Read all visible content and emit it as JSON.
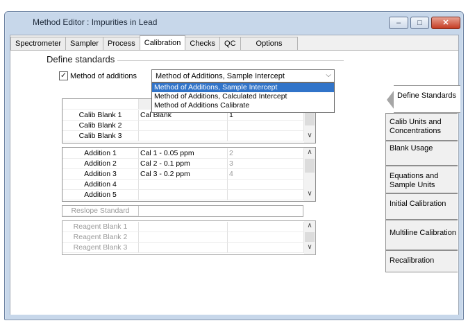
{
  "window": {
    "title": "Method Editor : Impurities in Lead",
    "min_icon": "minimize-icon",
    "max_icon": "restore-icon",
    "close_icon": "close-icon"
  },
  "tabs": [
    {
      "label": "Spectrometer"
    },
    {
      "label": "Sampler"
    },
    {
      "label": "Process"
    },
    {
      "label": "Calibration",
      "active": true
    },
    {
      "label": "Checks"
    },
    {
      "label": "QC"
    },
    {
      "label": "Options"
    }
  ],
  "define": {
    "title": "Define standards",
    "checkbox_label": "Method of additions",
    "checkbox_checked": true,
    "combo_value": "Method of Additions, Sample Intercept",
    "dropdown_options": [
      "Method of Additions, Sample Intercept",
      "Method of Additions, Calculated Intercept",
      "Method of Additions Calibrate"
    ]
  },
  "blank_table": {
    "rows": [
      {
        "name": "Calib Blank 1",
        "id": "Cal Blank",
        "value": "1"
      },
      {
        "name": "Calib Blank 2",
        "id": "",
        "value": ""
      },
      {
        "name": "Calib Blank 3",
        "id": "",
        "value": ""
      }
    ]
  },
  "addition_table": {
    "rows": [
      {
        "name": "Addition 1",
        "id": "Cal 1 - 0.05 ppm",
        "value": "2"
      },
      {
        "name": "Addition 2",
        "id": "Cal 2 - 0.1 ppm",
        "value": "3"
      },
      {
        "name": "Addition 3",
        "id": "Cal 3 - 0.2 ppm",
        "value": "4"
      },
      {
        "name": "Addition 4",
        "id": "",
        "value": ""
      },
      {
        "name": "Addition 5",
        "id": "",
        "value": ""
      }
    ]
  },
  "reslope": {
    "label": "Reslope Standard"
  },
  "reagent_table": {
    "rows": [
      {
        "name": "Reagent Blank 1"
      },
      {
        "name": "Reagent Blank 2"
      },
      {
        "name": "Reagent Blank 3"
      }
    ]
  },
  "nav": [
    {
      "label": "Define Standards",
      "active": true
    },
    {
      "label": "Calib Units and Concentrations"
    },
    {
      "label": "Blank Usage"
    },
    {
      "label": "Equations and Sample Units"
    },
    {
      "label": "Initial Calibration"
    },
    {
      "label": "Multiline Calibration"
    },
    {
      "label": "Recalibration"
    }
  ],
  "colors": {
    "selection": "#3174c9",
    "close_button": "#c53b22",
    "frame": "#c7d7ea"
  }
}
